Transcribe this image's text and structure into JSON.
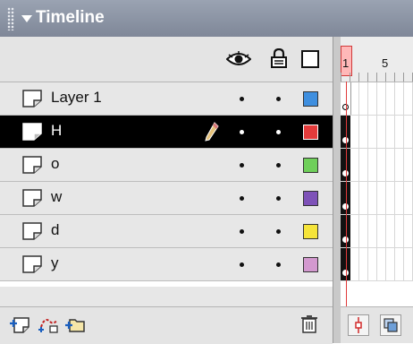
{
  "panel": {
    "title": "Timeline"
  },
  "header_icons": [
    "eye-icon",
    "lock-icon",
    "outline-icon"
  ],
  "layers": [
    {
      "name": "Layer 1",
      "selected": false,
      "color": "#3f8fdf",
      "editing": false
    },
    {
      "name": "H",
      "selected": true,
      "color": "#e33b3b",
      "editing": true
    },
    {
      "name": "o",
      "selected": false,
      "color": "#6fcf5a",
      "editing": false
    },
    {
      "name": "w",
      "selected": false,
      "color": "#7e52b8",
      "editing": false
    },
    {
      "name": "d",
      "selected": false,
      "color": "#f5e43a",
      "editing": false
    },
    {
      "name": "y",
      "selected": false,
      "color": "#d399cf",
      "editing": false
    }
  ],
  "frames": {
    "current_frame": "1",
    "ruler_labels": [
      "1",
      "5"
    ]
  },
  "footer_icons": [
    "insert-layer-icon",
    "add-motion-guide-icon",
    "insert-layer-folder-icon",
    "delete-layer-icon"
  ],
  "frames_footer_icons": [
    "center-frame-icon",
    "onion-skin-icon"
  ]
}
